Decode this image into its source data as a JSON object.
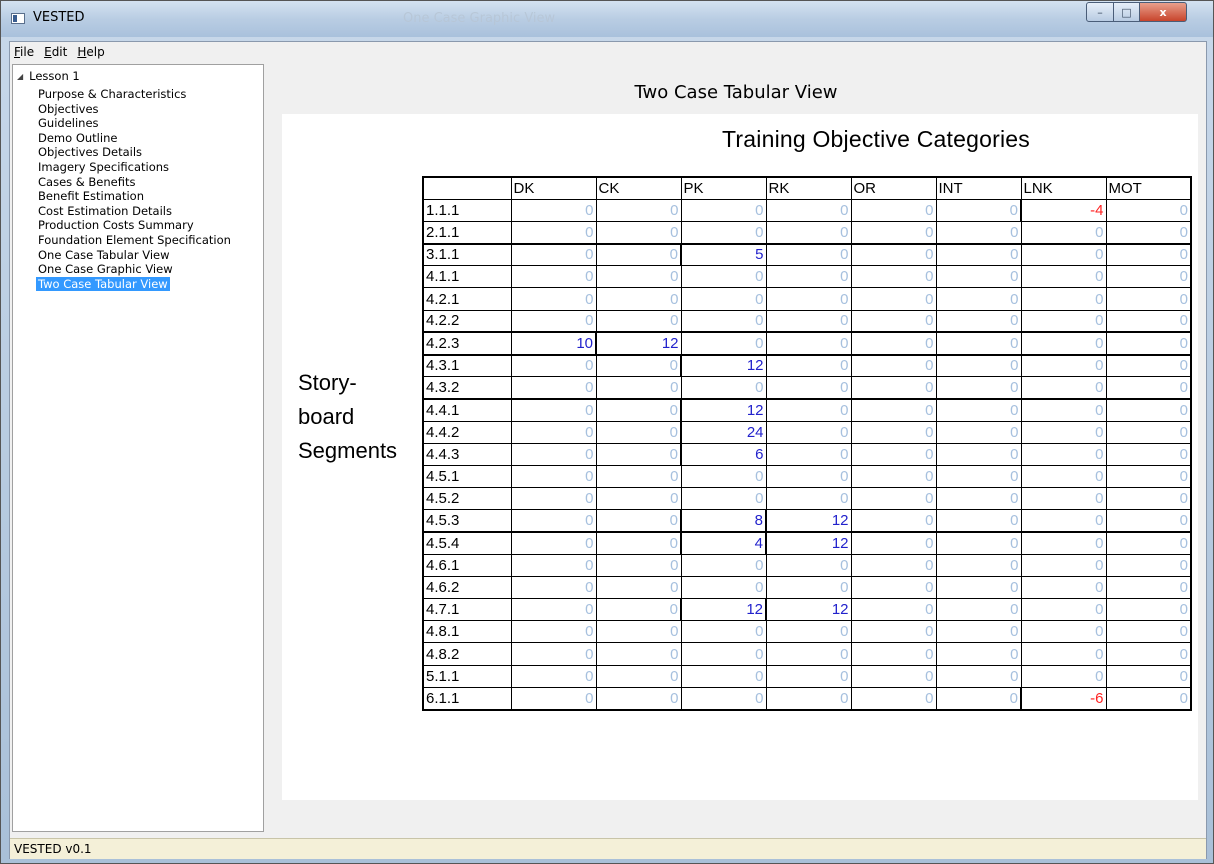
{
  "window": {
    "title": "VESTED",
    "ghost_title": "One Case Graphic View",
    "min_label": "–",
    "max_label": "□",
    "close_label": "x"
  },
  "menu": {
    "items": [
      {
        "label": "File",
        "key": "F",
        "rest": "ile"
      },
      {
        "label": "Edit",
        "key": "E",
        "rest": "dit"
      },
      {
        "label": "Help",
        "key": "H",
        "rest": "elp"
      }
    ]
  },
  "tree": {
    "root": "Lesson 1",
    "items": [
      "Purpose & Characteristics",
      "Objectives",
      "Guidelines",
      "Demo Outline",
      "Objectives Details",
      "Imagery Specifications",
      "Cases & Benefits",
      "Benefit Estimation",
      "Cost Estimation Details",
      "Production Costs Summary",
      "Foundation Element Specification",
      "One Case Tabular View",
      "One Case Graphic View",
      "Two Case Tabular View"
    ],
    "selected_index": 13
  },
  "main": {
    "title": "Two Case Tabular View",
    "category_title": "Training Objective Categories",
    "segments_label": [
      "Story-",
      "board",
      "Segments"
    ]
  },
  "chart_data": {
    "type": "table",
    "columns": [
      "DK",
      "CK",
      "PK",
      "RK",
      "OR",
      "INT",
      "LNK",
      "MOT"
    ],
    "rows": [
      {
        "label": "1.1.1",
        "values": [
          0,
          0,
          0,
          0,
          0,
          0,
          -4,
          0
        ]
      },
      {
        "label": "2.1.1",
        "values": [
          0,
          0,
          0,
          0,
          0,
          0,
          0,
          0
        ]
      },
      {
        "label": "3.1.1",
        "values": [
          0,
          0,
          5,
          0,
          0,
          0,
          0,
          0
        ]
      },
      {
        "label": "4.1.1",
        "values": [
          0,
          0,
          0,
          0,
          0,
          0,
          0,
          0
        ]
      },
      {
        "label": "4.2.1",
        "values": [
          0,
          0,
          0,
          0,
          0,
          0,
          0,
          0
        ]
      },
      {
        "label": "4.2.2",
        "values": [
          0,
          0,
          0,
          0,
          0,
          0,
          0,
          0
        ]
      },
      {
        "label": "4.2.3",
        "values": [
          10,
          12,
          0,
          0,
          0,
          0,
          0,
          0
        ]
      },
      {
        "label": "4.3.1",
        "values": [
          0,
          0,
          12,
          0,
          0,
          0,
          0,
          0
        ]
      },
      {
        "label": "4.3.2",
        "values": [
          0,
          0,
          0,
          0,
          0,
          0,
          0,
          0
        ]
      },
      {
        "label": "4.4.1",
        "values": [
          0,
          0,
          12,
          0,
          0,
          0,
          0,
          0
        ]
      },
      {
        "label": "4.4.2",
        "values": [
          0,
          0,
          24,
          0,
          0,
          0,
          0,
          0
        ]
      },
      {
        "label": "4.4.3",
        "values": [
          0,
          0,
          6,
          0,
          0,
          0,
          0,
          0
        ]
      },
      {
        "label": "4.5.1",
        "values": [
          0,
          0,
          0,
          0,
          0,
          0,
          0,
          0
        ]
      },
      {
        "label": "4.5.2",
        "values": [
          0,
          0,
          0,
          0,
          0,
          0,
          0,
          0
        ]
      },
      {
        "label": "4.5.3",
        "values": [
          0,
          0,
          8,
          12,
          0,
          0,
          0,
          0
        ]
      },
      {
        "label": "4.5.4",
        "values": [
          0,
          0,
          4,
          12,
          0,
          0,
          0,
          0
        ]
      },
      {
        "label": "4.6.1",
        "values": [
          0,
          0,
          0,
          0,
          0,
          0,
          0,
          0
        ]
      },
      {
        "label": "4.6.2",
        "values": [
          0,
          0,
          0,
          0,
          0,
          0,
          0,
          0
        ]
      },
      {
        "label": "4.7.1",
        "values": [
          0,
          0,
          12,
          12,
          0,
          0,
          0,
          0
        ]
      },
      {
        "label": "4.8.1",
        "values": [
          0,
          0,
          0,
          0,
          0,
          0,
          0,
          0
        ]
      },
      {
        "label": "4.8.2",
        "values": [
          0,
          0,
          0,
          0,
          0,
          0,
          0,
          0
        ]
      },
      {
        "label": "5.1.1",
        "values": [
          0,
          0,
          0,
          0,
          0,
          0,
          0,
          0
        ]
      },
      {
        "label": "6.1.1",
        "values": [
          0,
          0,
          0,
          0,
          0,
          0,
          -6,
          0
        ]
      }
    ],
    "colors": {
      "zero": "#a6c0de",
      "positive": "#2222cc",
      "negative": "#ff2222"
    }
  },
  "statusbar": {
    "text": "VESTED v0.1"
  }
}
